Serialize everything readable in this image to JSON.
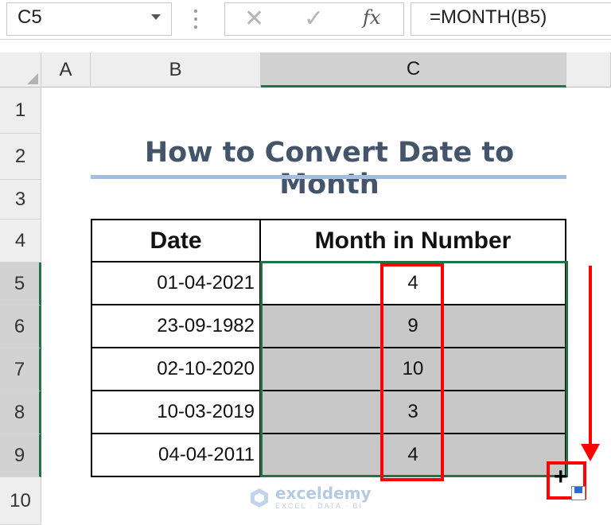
{
  "formula_bar": {
    "name_box": "C5",
    "cancel_icon": "✕",
    "enter_icon": "✓",
    "fx_label": "fx",
    "formula": "=MONTH(B5)"
  },
  "columns": {
    "a": "A",
    "b": "B",
    "c": "C"
  },
  "rows": [
    "1",
    "2",
    "3",
    "4",
    "5",
    "6",
    "7",
    "8",
    "9",
    "10"
  ],
  "sheet": {
    "title": "How to Convert Date to Month",
    "table": {
      "headers": {
        "date": "Date",
        "month": "Month in Number"
      },
      "rows": [
        {
          "date": "01-04-2021",
          "month": "4"
        },
        {
          "date": "23-09-1982",
          "month": "9"
        },
        {
          "date": "02-10-2020",
          "month": "10"
        },
        {
          "date": "10-03-2019",
          "month": "3"
        },
        {
          "date": "04-04-2011",
          "month": "4"
        }
      ]
    }
  },
  "watermark": {
    "name": "exceldemy",
    "tagline": "EXCEL · DATA · BI"
  },
  "colors": {
    "accent": "#217346",
    "annotation": "#ff0000",
    "title": "#44546a",
    "fill": "#c8c8c8"
  }
}
